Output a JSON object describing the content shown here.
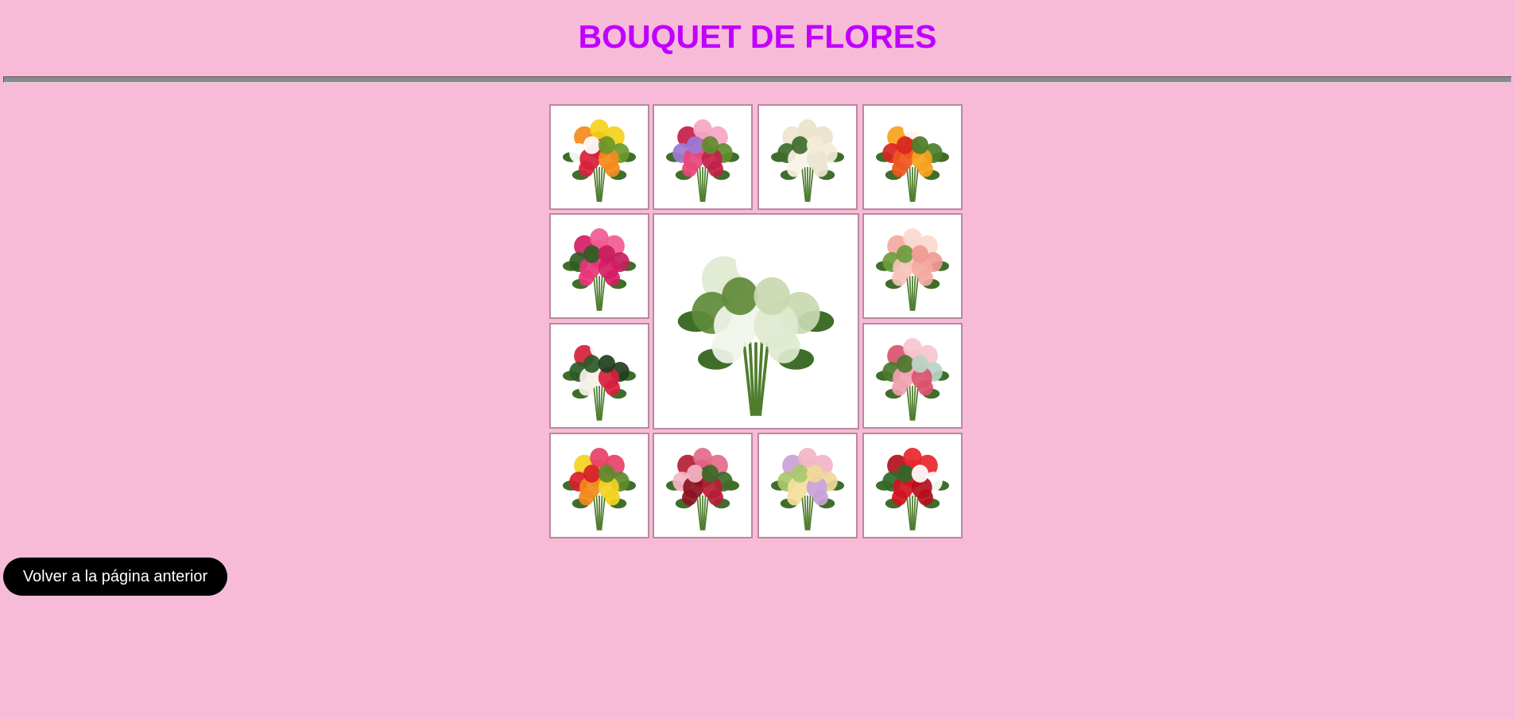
{
  "header": {
    "title": "BOUQUET DE FLORES"
  },
  "gallery": {
    "images": [
      {
        "name": "mixed-roses-bouquet-image",
        "colors": [
          "#d8203a",
          "#f58a1c",
          "#f4d21a",
          "#ffffff",
          "#6a9a2a"
        ]
      },
      {
        "name": "pink-lilies-bouquet-image",
        "colors": [
          "#e8457a",
          "#c21f4a",
          "#f6a6c4",
          "#9b7ad6",
          "#5e8c2e"
        ]
      },
      {
        "name": "white-roses-bouquet-image",
        "colors": [
          "#f7f3e6",
          "#ece5cf",
          "#e9e3cc",
          "#3f6b2a",
          "#f2ecd7"
        ]
      },
      {
        "name": "gerbera-bouquet-image",
        "colors": [
          "#f0561c",
          "#f7a21c",
          "#ffffff",
          "#d8261f",
          "#4d7d2a"
        ]
      },
      {
        "name": "pink-roses-bouquet-image",
        "colors": [
          "#e8347a",
          "#d41d64",
          "#f25b94",
          "#2f5d23",
          "#c71e5c"
        ]
      },
      {
        "name": "white-lilies-gerbera-bouquet-image",
        "colors": [
          "#f1f4ea",
          "#dfe9cf",
          "#ffffff",
          "#5e8a3a",
          "#c9d8b0"
        ]
      },
      {
        "name": "peach-roses-bouquet-image",
        "colors": [
          "#f7c3b8",
          "#f4a9a0",
          "#fbd9cf",
          "#6b9c3e",
          "#f09a92"
        ]
      },
      {
        "name": "red-white-roses-bouquet-image",
        "colors": [
          "#f4f1e8",
          "#d81e3c",
          "#ffffff",
          "#2d5a27",
          "#1f3f1c"
        ]
      },
      {
        "name": "pink-roses-vase-image",
        "colors": [
          "#f1a1b0",
          "#d9526e",
          "#f7c6cf",
          "#4b7a30",
          "#b8d4c6"
        ]
      },
      {
        "name": "colorful-roses-vase-image",
        "colors": [
          "#f28a1c",
          "#f3d11f",
          "#e8406a",
          "#d81e2a",
          "#5d8a2c"
        ]
      },
      {
        "name": "dark-red-roses-bouquet-image",
        "colors": [
          "#8c1220",
          "#b51d35",
          "#e46a8a",
          "#f4b6c6",
          "#3e6a2a"
        ]
      },
      {
        "name": "pastel-flowers-arrangement-image",
        "colors": [
          "#f4e0a0",
          "#c9a2d8",
          "#f2b4c8",
          "#a8c86a",
          "#efd79a"
        ]
      },
      {
        "name": "red-roses-bouquet-image",
        "colors": [
          "#d3141f",
          "#b30f1c",
          "#e8262c",
          "#2f6a2a",
          "#ffffff"
        ]
      }
    ]
  },
  "actions": {
    "back_label": "Volver a la página anterior"
  }
}
